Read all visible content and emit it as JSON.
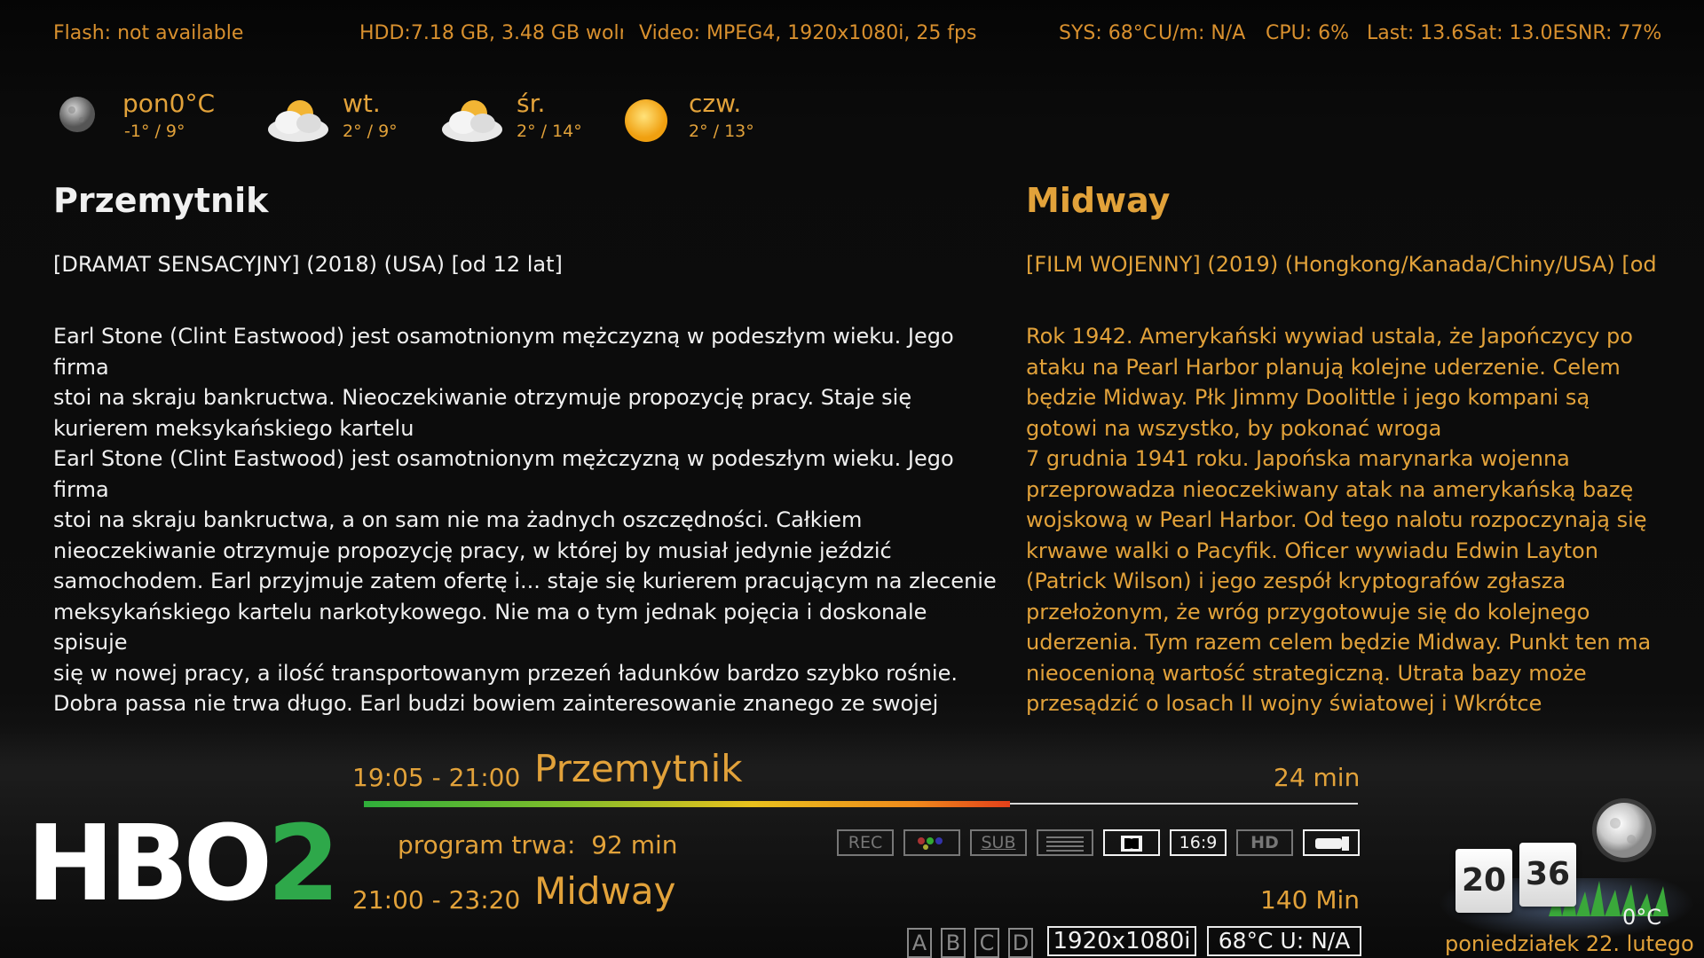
{
  "status": {
    "flash_label": "Flash:",
    "flash_value": "not available",
    "hdd": "HDD:7.18 GB, 3.48 GB woln",
    "video": "Video: MPEG4, 1920x1080i, 25 fps",
    "sys": "SYS: 68°C",
    "um": "U/m:  N/A",
    "cpu": "CPU:  6%",
    "last": "Last: 13.6",
    "sat": "Sat: 13.0E",
    "snr": "SNR: 77%"
  },
  "weather": [
    {
      "day": "pon",
      "now": "0°C",
      "range": "-1° / 9°",
      "icon": "moon-icon"
    },
    {
      "day": "wt.",
      "range": "2° / 9°",
      "icon": "partly-cloudy-icon"
    },
    {
      "day": "śr.",
      "range": "2° / 14°",
      "icon": "partly-cloudy-icon"
    },
    {
      "day": "czw.",
      "range": "2° / 13°",
      "icon": "sun-icon"
    }
  ],
  "current": {
    "title": "Przemytnik",
    "meta": "[DRAMAT SENSACYJNY]  (2018) (USA) [od 12 lat]",
    "description": "Earl Stone (Clint Eastwood) jest osamotnionym mężczyzną w podeszłym wieku. Jego firma\nstoi na skraju bankructwa. Nieoczekiwanie otrzymuje propozycję pracy. Staje się\nkurierem meksykańskiego kartelu\nEarl Stone (Clint Eastwood) jest osamotnionym mężczyzną w podeszłym wieku. Jego firma\nstoi na skraju bankructwa, a on sam nie ma żadnych oszczędności. Całkiem\nnieoczekiwanie otrzymuje propozycję pracy, w której by musiał jedynie jeździć\nsamochodem. Earl przyjmuje zatem ofertę i... staje się kurierem pracującym na zlecenie\nmeksykańskiego kartelu narkotykowego. Nie ma o tym jednak pojęcia i doskonale spisuje\nsię w nowej pracy, a ilość transportowanym przezeń ładunków bardzo szybko rośnie.\nDobra passa nie trwa długo. Earl budzi bowiem zainteresowanie znanego ze swojej\ndeterminacji agenta Colina Batesa (Bradley Cooper). W roli głównej zdobywca czterech\nOscarów Clint Eastwood (m.in. za film \"Za wszelką cenę\").\nClint Eastwood"
  },
  "next": {
    "title": "Midway",
    "meta": "[FILM WOJENNY]  (2019) (Hongkong/Kanada/Chiny/USA) [od",
    "description": "Rok 1942. Amerykański wywiad ustala, że Japończycy po\nataku na Pearl Harbor planują kolejne uderzenie. Celem\nbędzie Midway. Płk Jimmy Doolittle i jego kompani są\ngotowi na wszystko, by pokonać wroga\n7 grudnia 1941 roku. Japońska marynarka wojenna\nprzeprowadza nieoczekiwany atak na amerykańską bazę\nwojskową w Pearl Harbor. Od tego nalotu rozpoczynają się\nkrwawe walki o Pacyfik. Oficer wywiadu Edwin Layton\n(Patrick Wilson) i jego zespół kryptografów zgłasza\nprzełożonym, że wróg przygotowuje się do kolejnego\nuderzenia. Tym razem celem będzie Midway. Punkt ten ma\nnieocenioną wartość strategiczną. Utrata bazy może\nprzesądzić o losach II wojny światowej i Wkrótce"
  },
  "infobar": {
    "channel_logo_text": "HBO",
    "channel_logo_number": "2",
    "now_time": "19:05  -  21:00",
    "now_title": "Przemytnik",
    "now_remaining": "24 min",
    "progress_fraction": 0.65,
    "running_label": "program trwa:",
    "running_value": "92 min",
    "next_time": "21:00  -  23:20",
    "next_title": "Midway",
    "next_duration": "140 Min",
    "flags": [
      {
        "label": "REC",
        "active": false
      },
      {
        "label": "",
        "active": false,
        "icon": "color-dots-icon"
      },
      {
        "label": "SUB",
        "active": true
      },
      {
        "label": "",
        "active": false,
        "icon": "teletext-icon"
      },
      {
        "label": "",
        "active": true,
        "icon": "dolby-icon"
      },
      {
        "label": "16:9",
        "active": true
      },
      {
        "label": "HD",
        "active": false
      },
      {
        "label": "",
        "active": true,
        "icon": "ci-card-icon"
      }
    ],
    "abcd": [
      {
        "label": "A",
        "active": true
      },
      {
        "label": "B",
        "active": false
      },
      {
        "label": "C",
        "active": false
      },
      {
        "label": "D",
        "active": false
      }
    ],
    "resolution": "1920x1080i",
    "temp_fan": "68°C  U:  N/A"
  },
  "clock": {
    "hour": "20",
    "minute": "36",
    "temperature": "0°C",
    "date": "poniedziałek  22. lutego"
  },
  "colors": {
    "accent": "#e2a23a",
    "text": "#f0f0f0",
    "logo_number": "#2ea84a"
  }
}
